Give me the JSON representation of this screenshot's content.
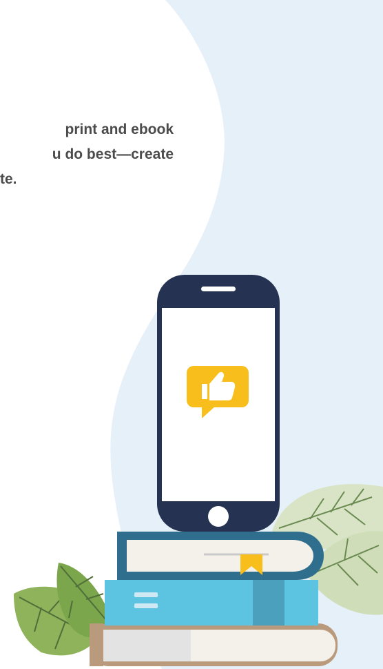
{
  "intro": {
    "lines": [
      "print and ebook",
      "u do best—create",
      "te."
    ]
  },
  "colors": {
    "background_blue": "#e6f0f9",
    "phone_body": "#263251",
    "thumbs_badge": "#f8bf1c",
    "book_top": "#2f6f8d",
    "book_middle": "#5cc3e0",
    "book_bottom": "#b99a7c",
    "leaf_light": "#d8e4c5",
    "leaf_dark": "#8eb35a"
  },
  "icons": {
    "phone_badge": "thumbs-up-icon",
    "book_bookmark": "bookmark-icon"
  }
}
